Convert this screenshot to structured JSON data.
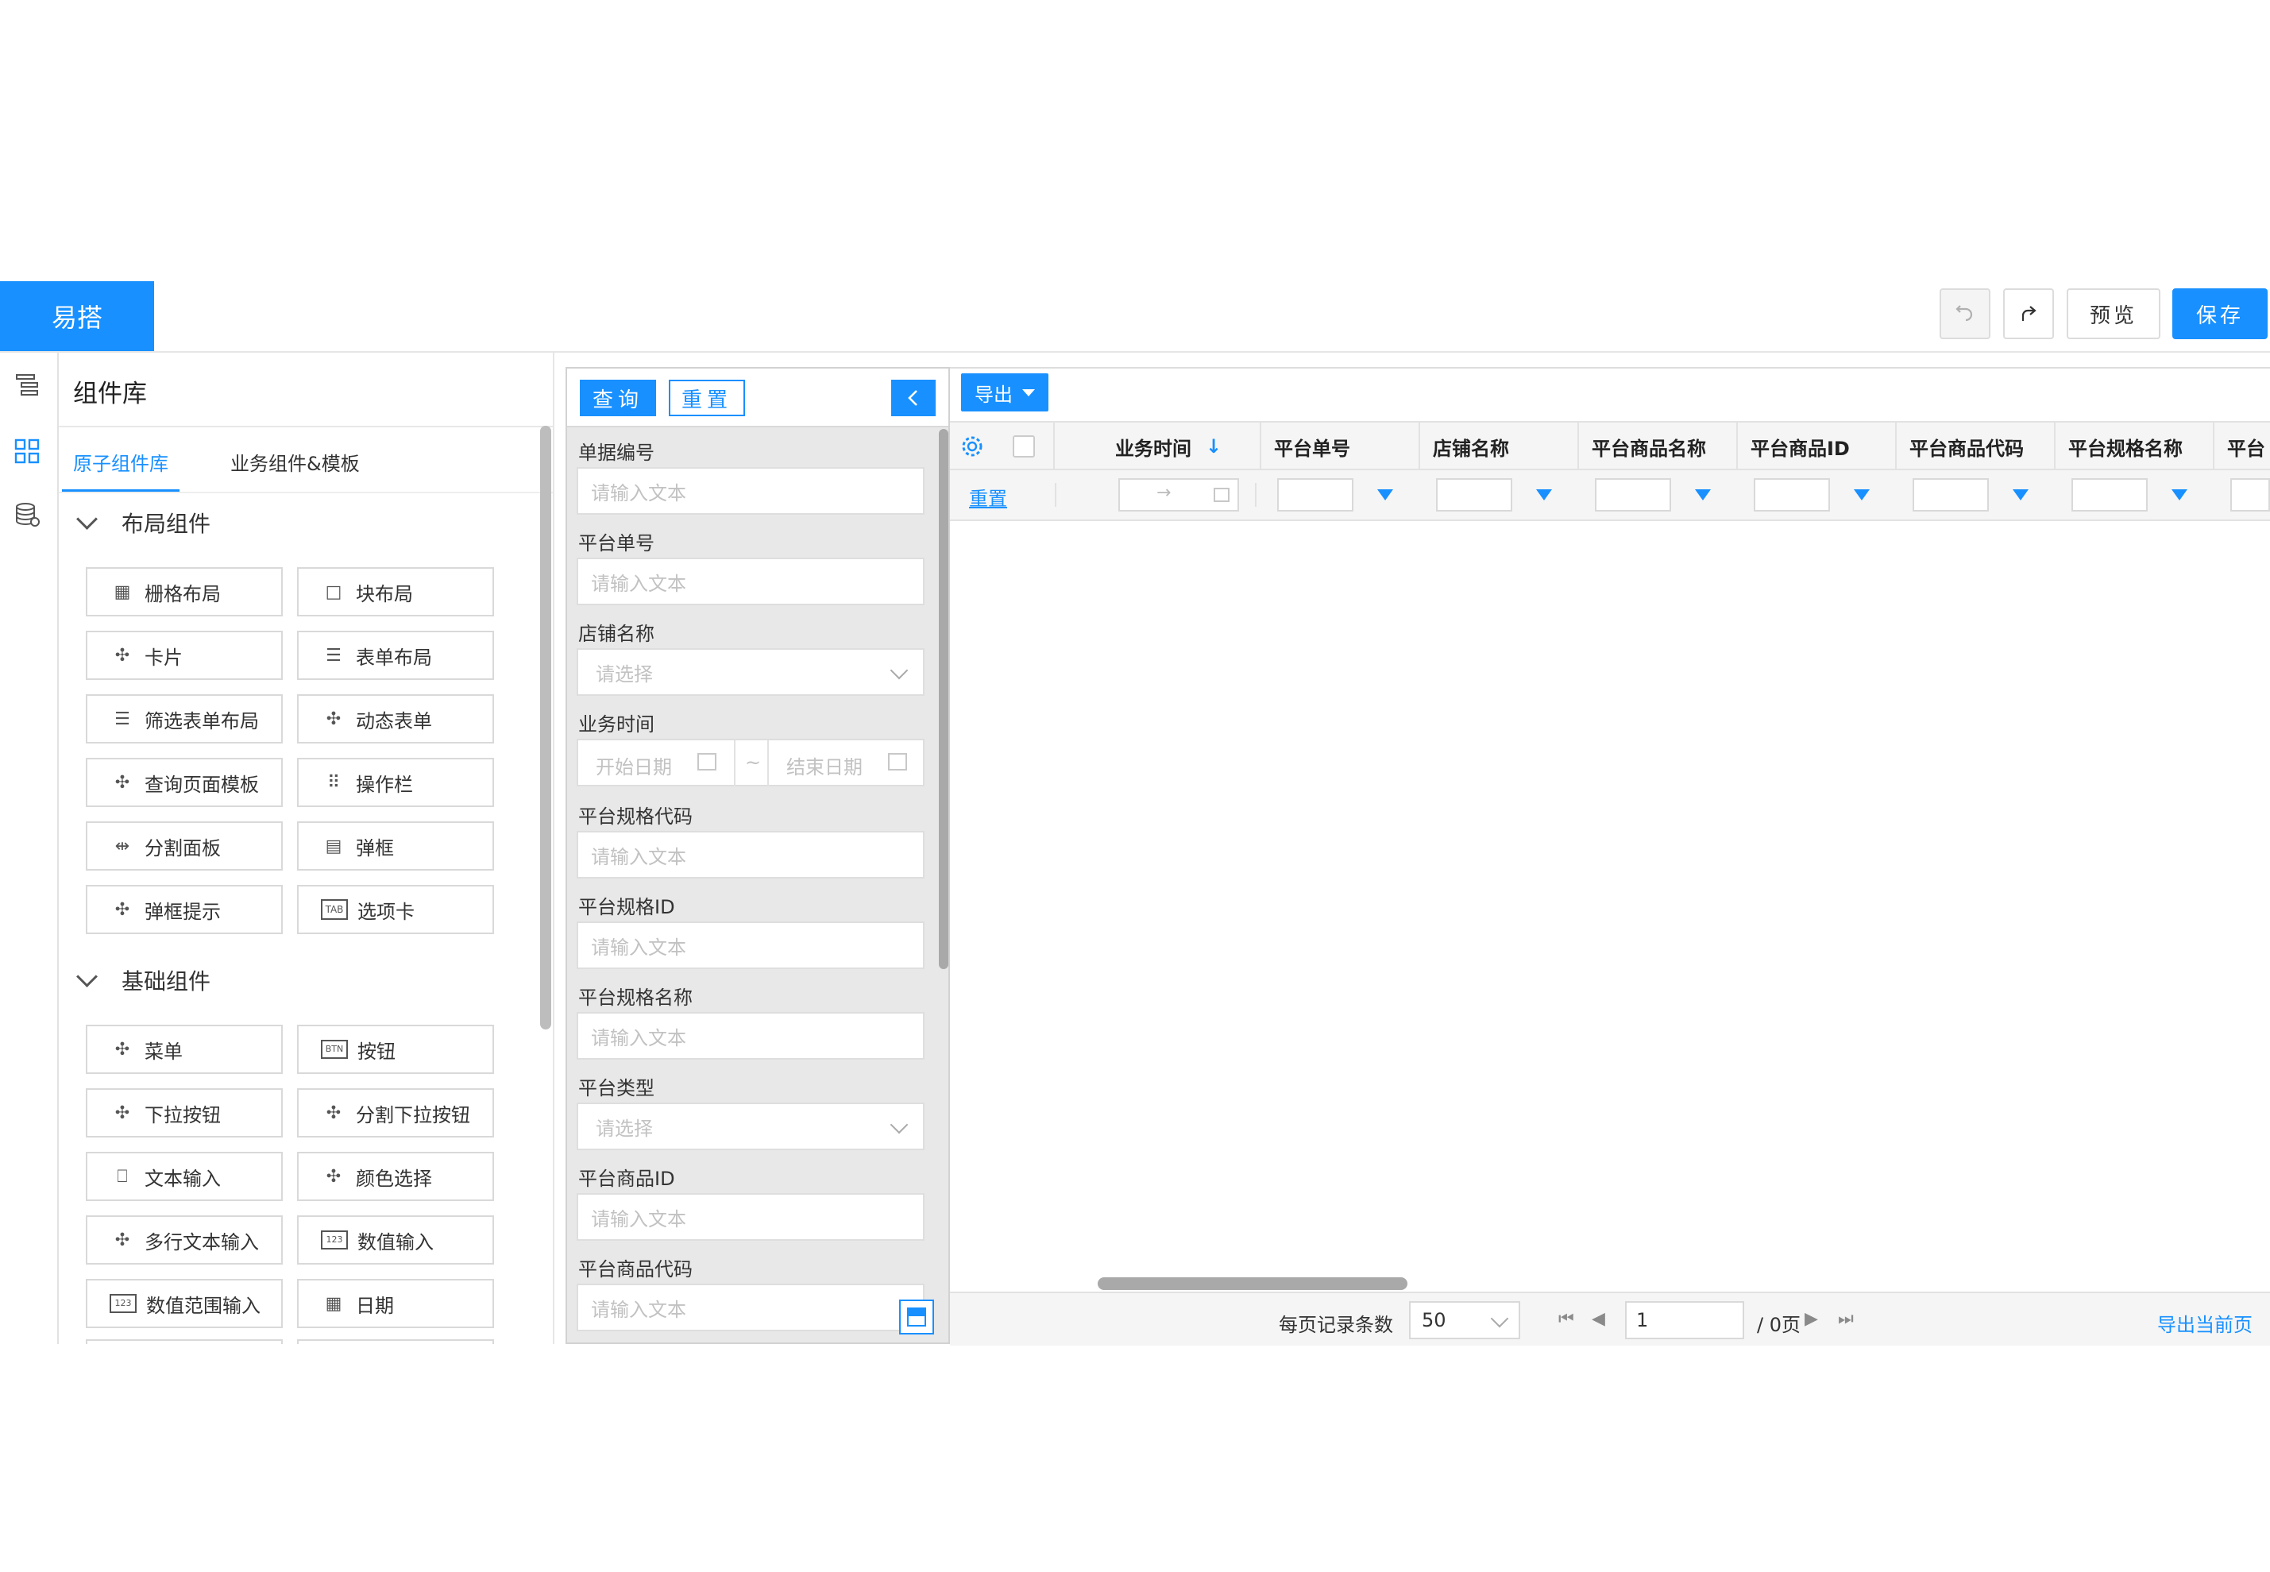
{
  "header": {
    "logo": "易搭",
    "undo_icon": "undo-icon",
    "redo_icon": "redo-icon",
    "preview_label": "预览",
    "save_label": "保存"
  },
  "rail": [
    "outline-icon",
    "components-icon",
    "datasource-icon"
  ],
  "library": {
    "title": "组件库",
    "tabs": [
      "原子组件库",
      "业务组件&模板"
    ],
    "active_tab": "原子组件库",
    "sections": [
      {
        "title": "布局组件",
        "items": [
          {
            "label": "栅格布局",
            "icon": "grid-layout-icon"
          },
          {
            "label": "块布局",
            "icon": "block-layout-icon"
          },
          {
            "label": "卡片",
            "icon": "puzzle-icon"
          },
          {
            "label": "表单布局",
            "icon": "form-layout-icon"
          },
          {
            "label": "筛选表单布局",
            "icon": "form-layout-icon"
          },
          {
            "label": "动态表单",
            "icon": "puzzle-icon"
          },
          {
            "label": "查询页面模板",
            "icon": "puzzle-icon"
          },
          {
            "label": "操作栏",
            "icon": "dots-icon"
          },
          {
            "label": "分割面板",
            "icon": "split-icon"
          },
          {
            "label": "弹框",
            "icon": "dialog-icon"
          },
          {
            "label": "弹框提示",
            "icon": "puzzle-icon"
          },
          {
            "label": "选项卡",
            "icon": "tab-icon"
          }
        ]
      },
      {
        "title": "基础组件",
        "items": [
          {
            "label": "菜单",
            "icon": "puzzle-icon"
          },
          {
            "label": "按钮",
            "icon": "btn-icon"
          },
          {
            "label": "下拉按钮",
            "icon": "puzzle-icon"
          },
          {
            "label": "分割下拉按钮",
            "icon": "puzzle-icon"
          },
          {
            "label": "文本输入",
            "icon": "text-input-icon"
          },
          {
            "label": "颜色选择",
            "icon": "puzzle-icon"
          },
          {
            "label": "多行文本输入",
            "icon": "puzzle-icon"
          },
          {
            "label": "数值输入",
            "icon": "number-input-icon"
          },
          {
            "label": "数值范围输入",
            "icon": "number-input-icon"
          },
          {
            "label": "日期",
            "icon": "calendar-icon"
          }
        ]
      }
    ]
  },
  "filter": {
    "query_label": "查询",
    "reset_label": "重置",
    "collapse_icon": "chevron-left-icon",
    "fields": [
      {
        "label": "单据编号",
        "type": "text",
        "placeholder": "请输入文本"
      },
      {
        "label": "平台单号",
        "type": "text",
        "placeholder": "请输入文本"
      },
      {
        "label": "店铺名称",
        "type": "select",
        "placeholder": "请选择"
      },
      {
        "label": "业务时间",
        "type": "daterange",
        "start": "开始日期",
        "sep": "~",
        "end": "结束日期"
      },
      {
        "label": "平台规格代码",
        "type": "text",
        "placeholder": "请输入文本"
      },
      {
        "label": "平台规格ID",
        "type": "text",
        "placeholder": "请输入文本"
      },
      {
        "label": "平台规格名称",
        "type": "text",
        "placeholder": "请输入文本"
      },
      {
        "label": "平台类型",
        "type": "select",
        "placeholder": "请选择"
      },
      {
        "label": "平台商品ID",
        "type": "text",
        "placeholder": "请输入文本"
      },
      {
        "label": "平台商品代码",
        "type": "text",
        "placeholder": "请输入文本"
      }
    ]
  },
  "grid": {
    "export_label": "导出",
    "settings_icon": "gear-icon",
    "columns": [
      "业务时间",
      "平台单号",
      "店铺名称",
      "平台商品名称",
      "平台商品ID",
      "平台商品代码",
      "平台规格名称",
      "平台"
    ],
    "sort_icon": "arrow-down-icon",
    "reset_label": "重置",
    "footer": {
      "page_size_label": "每页记录条数",
      "page_size": "50",
      "page": "1",
      "total_pages": "/ 0页",
      "export_current": "导出当前页"
    }
  }
}
